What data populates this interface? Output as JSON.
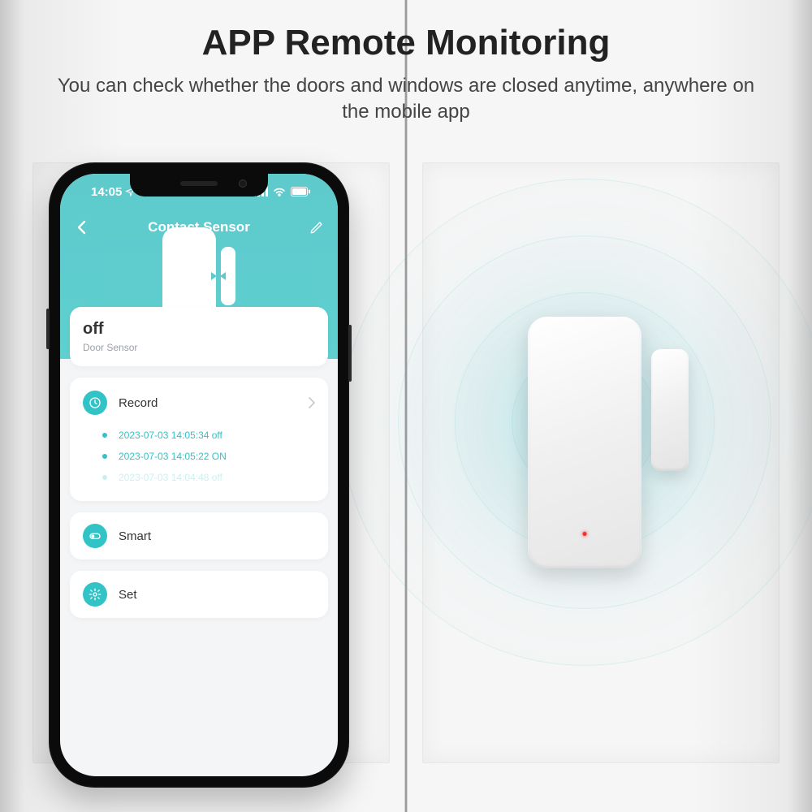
{
  "heading": "APP Remote Monitoring",
  "subheading": "You can check whether the doors and windows are closed anytime, anywhere on the mobile app",
  "statusbar": {
    "time": "14:05"
  },
  "app": {
    "title": "Contact Sensor",
    "status": {
      "state": "off",
      "label": "Door Sensor"
    },
    "record": {
      "label": "Record",
      "items": [
        "2023-07-03 14:05:34 off",
        "2023-07-03 14:05:22 ON",
        "2023-07-03 14:04:48 off"
      ]
    },
    "smart": {
      "label": "Smart"
    },
    "set": {
      "label": "Set"
    }
  }
}
